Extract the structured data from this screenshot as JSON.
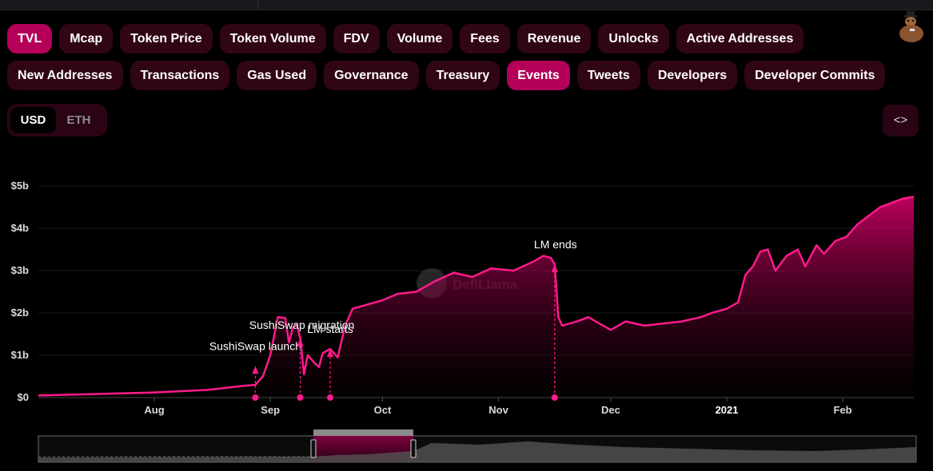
{
  "tabs_row1": [
    "TVL",
    "Mcap",
    "Token Price",
    "Token Volume",
    "FDV",
    "Volume",
    "Fees",
    "Revenue",
    "Unlocks",
    "Active Addresses"
  ],
  "tabs_row2": [
    "New Addresses",
    "Transactions",
    "Gas Used",
    "Governance",
    "Treasury",
    "Events",
    "Tweets",
    "Developers",
    "Developer Commits"
  ],
  "active_tabs": [
    "TVL",
    "Events"
  ],
  "denomination": {
    "options": [
      "USD",
      "ETH"
    ],
    "selected": "USD"
  },
  "embed_button_label": "<>",
  "colors": {
    "accent": "#ff1a8c",
    "pill_bg": "#300516",
    "pill_active": "#b5005a",
    "background": "#000000"
  },
  "watermark": "DefiLlama",
  "chart_data": {
    "type": "area",
    "y_axis": {
      "ticks": [
        "$0",
        "$1b",
        "$2b",
        "$3b",
        "$4b",
        "$5b"
      ],
      "range_b": [
        0,
        5
      ]
    },
    "x_axis": {
      "ticks": [
        "Aug",
        "Sep",
        "Oct",
        "Nov",
        "Dec",
        "2021",
        "Feb"
      ],
      "bold_ticks": [
        "2021"
      ],
      "range": [
        "2020-07-01",
        "2021-02-20"
      ]
    },
    "grid": true,
    "series": [
      {
        "values_usd_b": [
          [
            "2020-07-01",
            0.05
          ],
          [
            "2020-07-15",
            0.08
          ],
          [
            "2020-08-01",
            0.12
          ],
          [
            "2020-08-15",
            0.18
          ],
          [
            "2020-08-25",
            0.28
          ],
          [
            "2020-08-28",
            0.3
          ],
          [
            "2020-08-30",
            0.5
          ],
          [
            "2020-09-01",
            1.0
          ],
          [
            "2020-09-03",
            1.9
          ],
          [
            "2020-09-05",
            1.88
          ],
          [
            "2020-09-06",
            1.3
          ],
          [
            "2020-09-07",
            1.65
          ],
          [
            "2020-09-08",
            1.75
          ],
          [
            "2020-09-09",
            1.4
          ],
          [
            "2020-09-10",
            0.55
          ],
          [
            "2020-09-11",
            1.0
          ],
          [
            "2020-09-13",
            0.8
          ],
          [
            "2020-09-14",
            0.72
          ],
          [
            "2020-09-15",
            1.05
          ],
          [
            "2020-09-17",
            1.15
          ],
          [
            "2020-09-19",
            0.95
          ],
          [
            "2020-09-21",
            1.7
          ],
          [
            "2020-09-23",
            2.1
          ],
          [
            "2020-09-25",
            2.15
          ],
          [
            "2020-10-01",
            2.3
          ],
          [
            "2020-10-05",
            2.45
          ],
          [
            "2020-10-10",
            2.5
          ],
          [
            "2020-10-15",
            2.75
          ],
          [
            "2020-10-20",
            2.95
          ],
          [
            "2020-10-25",
            2.85
          ],
          [
            "2020-10-30",
            3.05
          ],
          [
            "2020-11-05",
            3.0
          ],
          [
            "2020-11-10",
            3.2
          ],
          [
            "2020-11-13",
            3.35
          ],
          [
            "2020-11-15",
            3.3
          ],
          [
            "2020-11-16",
            3.15
          ],
          [
            "2020-11-17",
            1.9
          ],
          [
            "2020-11-18",
            1.7
          ],
          [
            "2020-11-22",
            1.8
          ],
          [
            "2020-11-25",
            1.9
          ],
          [
            "2020-11-28",
            1.75
          ],
          [
            "2020-12-01",
            1.6
          ],
          [
            "2020-12-05",
            1.8
          ],
          [
            "2020-12-10",
            1.7
          ],
          [
            "2020-12-15",
            1.75
          ],
          [
            "2020-12-20",
            1.8
          ],
          [
            "2020-12-25",
            1.9
          ],
          [
            "2020-12-28",
            2.0
          ],
          [
            "2021-01-01",
            2.1
          ],
          [
            "2021-01-04",
            2.25
          ],
          [
            "2021-01-06",
            2.9
          ],
          [
            "2021-01-08",
            3.1
          ],
          [
            "2021-01-10",
            3.45
          ],
          [
            "2021-01-12",
            3.5
          ],
          [
            "2021-01-14",
            3.0
          ],
          [
            "2021-01-17",
            3.35
          ],
          [
            "2021-01-20",
            3.5
          ],
          [
            "2021-01-22",
            3.1
          ],
          [
            "2021-01-25",
            3.6
          ],
          [
            "2021-01-27",
            3.4
          ],
          [
            "2021-01-30",
            3.7
          ],
          [
            "2021-02-02",
            3.8
          ],
          [
            "2021-02-05",
            4.1
          ],
          [
            "2021-02-08",
            4.3
          ],
          [
            "2021-02-11",
            4.5
          ],
          [
            "2021-02-14",
            4.6
          ],
          [
            "2021-02-17",
            4.7
          ],
          [
            "2021-02-20",
            4.75
          ]
        ]
      }
    ],
    "events": [
      {
        "label": "SushiSwap launch",
        "date": "2020-08-28"
      },
      {
        "label": "SushiSwap migration",
        "date": "2020-09-09"
      },
      {
        "label": "LM starts",
        "date": "2020-09-17"
      },
      {
        "label": "LM ends",
        "date": "2020-11-16"
      }
    ],
    "brush": {
      "selected_from": "2020-07-01",
      "selected_to": "2021-02-20"
    }
  }
}
